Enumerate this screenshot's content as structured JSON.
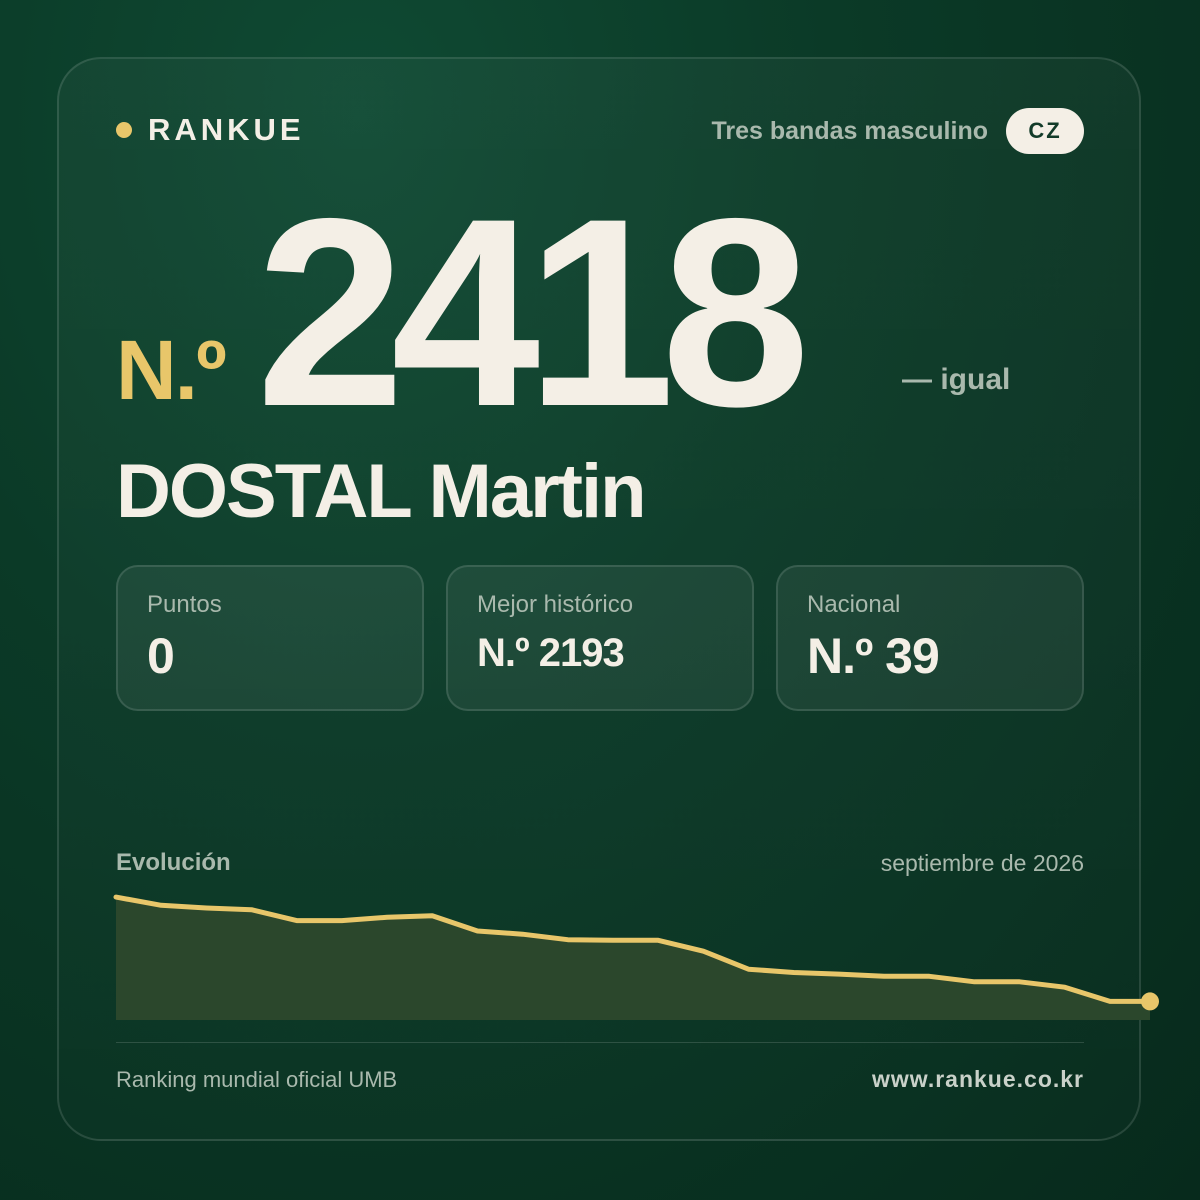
{
  "brand": {
    "name": "RANKUE"
  },
  "header": {
    "category": "Tres bandas masculino",
    "country": "CZ"
  },
  "rank": {
    "prefix": "N.º",
    "number": "2418",
    "change": "— igual"
  },
  "player": {
    "name": "DOSTAL Martin"
  },
  "stats": [
    {
      "label": "Puntos",
      "value": "0"
    },
    {
      "label": "Mejor histórico",
      "value": "N.º 2193"
    },
    {
      "label": "Nacional",
      "value": "N.º 39"
    }
  ],
  "chart": {
    "title": "Evolución",
    "date": "septiembre de 2026"
  },
  "chart_data": {
    "type": "area",
    "title": "Evolución",
    "series": [
      {
        "values": [
          2193,
          2208,
          2213,
          2216,
          2236,
          2236,
          2230,
          2227,
          2255,
          2261,
          2271,
          2272,
          2272,
          2292,
          2325,
          2331,
          2334,
          2338,
          2338,
          2348,
          2348,
          2358,
          2384,
          2384
        ]
      }
    ],
    "y_inverted": true,
    "ylim": [
      2180,
      2418
    ],
    "colors": {
      "line": "#e8c66a",
      "fill": "#2b472c"
    }
  },
  "footer": {
    "left": "Ranking mundial oficial UMB",
    "right": "www.rankue.co.kr"
  }
}
